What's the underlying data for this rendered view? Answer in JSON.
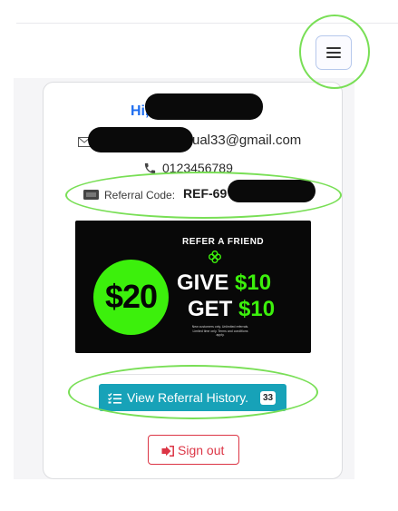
{
  "header": {
    "menu_icon": "hamburger-icon"
  },
  "profile": {
    "greeting": "Hi,",
    "email_visible_part": "ual33@gmail.com",
    "phone": "0123456789",
    "referral_label": "Referral Code:",
    "referral_code_visible": "REF-69",
    "icons": {
      "email": "envelope-icon",
      "phone": "phone-icon",
      "referral": "ticket-icon"
    }
  },
  "promo": {
    "amount": "$20",
    "title": "REFER A FRIEND",
    "give_label": "GIVE",
    "give_amount": "$10",
    "get_label": "GET",
    "get_amount": "$10",
    "fine_print": "New customers only. Unlimited referrals. Limited time only. Terms and conditions apply.",
    "accent_color": "#3cf00c"
  },
  "actions": {
    "history_label": "View Referral History.",
    "history_count": "33",
    "history_icon": "list-check-icon",
    "signout_label": "Sign out",
    "signout_icon": "sign-out-icon"
  },
  "colors": {
    "primary": "#1f6ef0",
    "info": "#17a2b8",
    "danger": "#dc3545",
    "annotation": "#79df56"
  }
}
